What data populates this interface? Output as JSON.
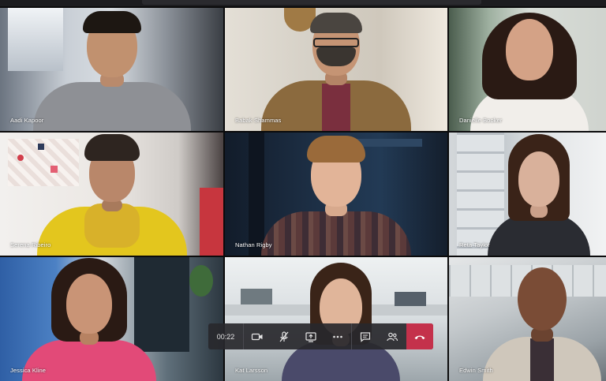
{
  "participants": [
    {
      "name": "Aadi Kapoor"
    },
    {
      "name": "Babak Shammas"
    },
    {
      "name": "Danielle Booker"
    },
    {
      "name": "Serena Ribeiro"
    },
    {
      "name": "Nathan Rigby"
    },
    {
      "name": "Reta Taylor"
    },
    {
      "name": "Jessica Kline"
    },
    {
      "name": "Kat Larsson"
    },
    {
      "name": "Edwin Smith"
    }
  ],
  "controls": {
    "timer": "00:22",
    "buttons": [
      "video-camera-icon",
      "mic-muted-icon",
      "share-screen-icon",
      "more-options-icon",
      "chat-icon",
      "participants-icon",
      "hang-up-icon"
    ]
  },
  "colors": {
    "hangup": "#c4314b",
    "controls_bg": "#28282c"
  }
}
